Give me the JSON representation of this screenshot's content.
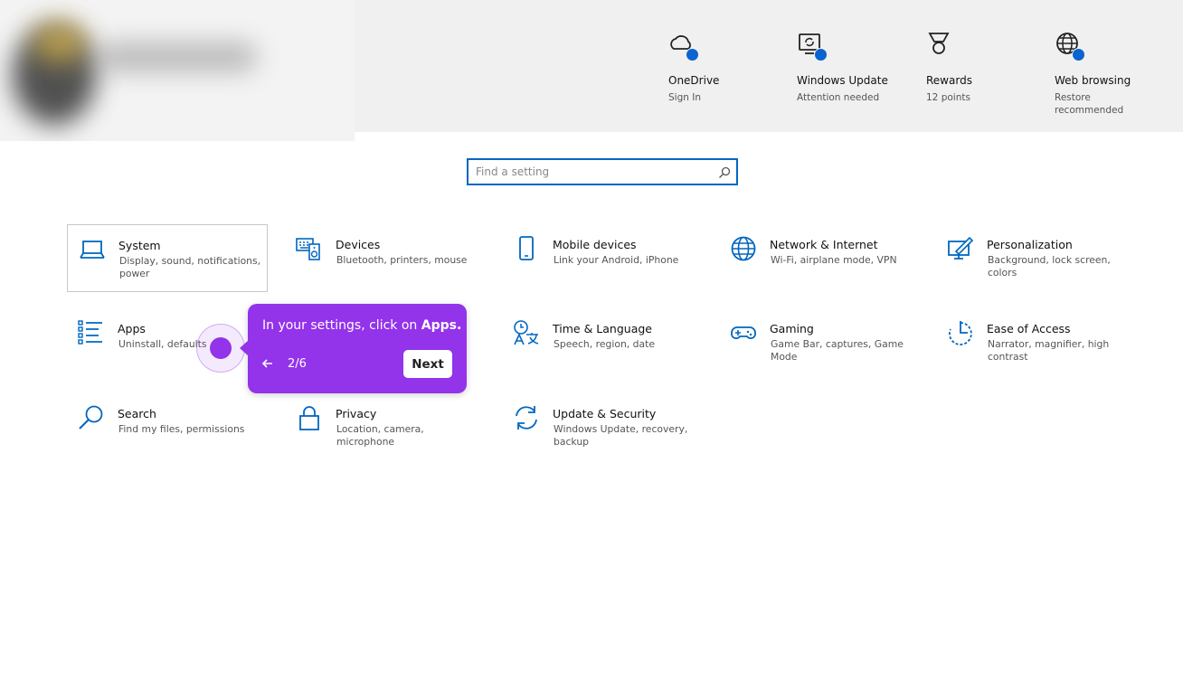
{
  "header": {
    "quick_links": [
      {
        "title": "OneDrive",
        "subtitle": "Sign In"
      },
      {
        "title": "Windows Update",
        "subtitle": "Attention needed"
      },
      {
        "title": "Rewards",
        "subtitle": "12 points"
      },
      {
        "title": "Web browsing",
        "subtitle": "Restore recommended"
      }
    ]
  },
  "search": {
    "placeholder": "Find a setting"
  },
  "categories": [
    {
      "name": "System",
      "desc": "Display, sound, notifications, power"
    },
    {
      "name": "Devices",
      "desc": "Bluetooth, printers, mouse"
    },
    {
      "name": "Mobile devices",
      "desc": "Link your Android, iPhone"
    },
    {
      "name": "Network & Internet",
      "desc": "Wi-Fi, airplane mode, VPN"
    },
    {
      "name": "Personalization",
      "desc": "Background, lock screen, colors"
    },
    {
      "name": "Apps",
      "desc": "Uninstall, defaults"
    },
    {
      "name": "Time & Language",
      "desc": "Speech, region, date"
    },
    {
      "name": "Gaming",
      "desc": "Game Bar, captures, Game Mode"
    },
    {
      "name": "Ease of Access",
      "desc": "Narrator, magnifier, high contrast"
    },
    {
      "name": "Search",
      "desc": "Find my files, permissions"
    },
    {
      "name": "Privacy",
      "desc": "Location, camera, microphone"
    },
    {
      "name": "Update & Security",
      "desc": "Windows Update, recovery, backup"
    }
  ],
  "tooltip": {
    "message_prefix": "In your settings, click on ",
    "message_bold": "Apps.",
    "step": "2/6",
    "next_label": "Next"
  },
  "colors": {
    "accent": "#0067c0",
    "tooltip": "#9333ea",
    "badge": "#0a64d0"
  }
}
